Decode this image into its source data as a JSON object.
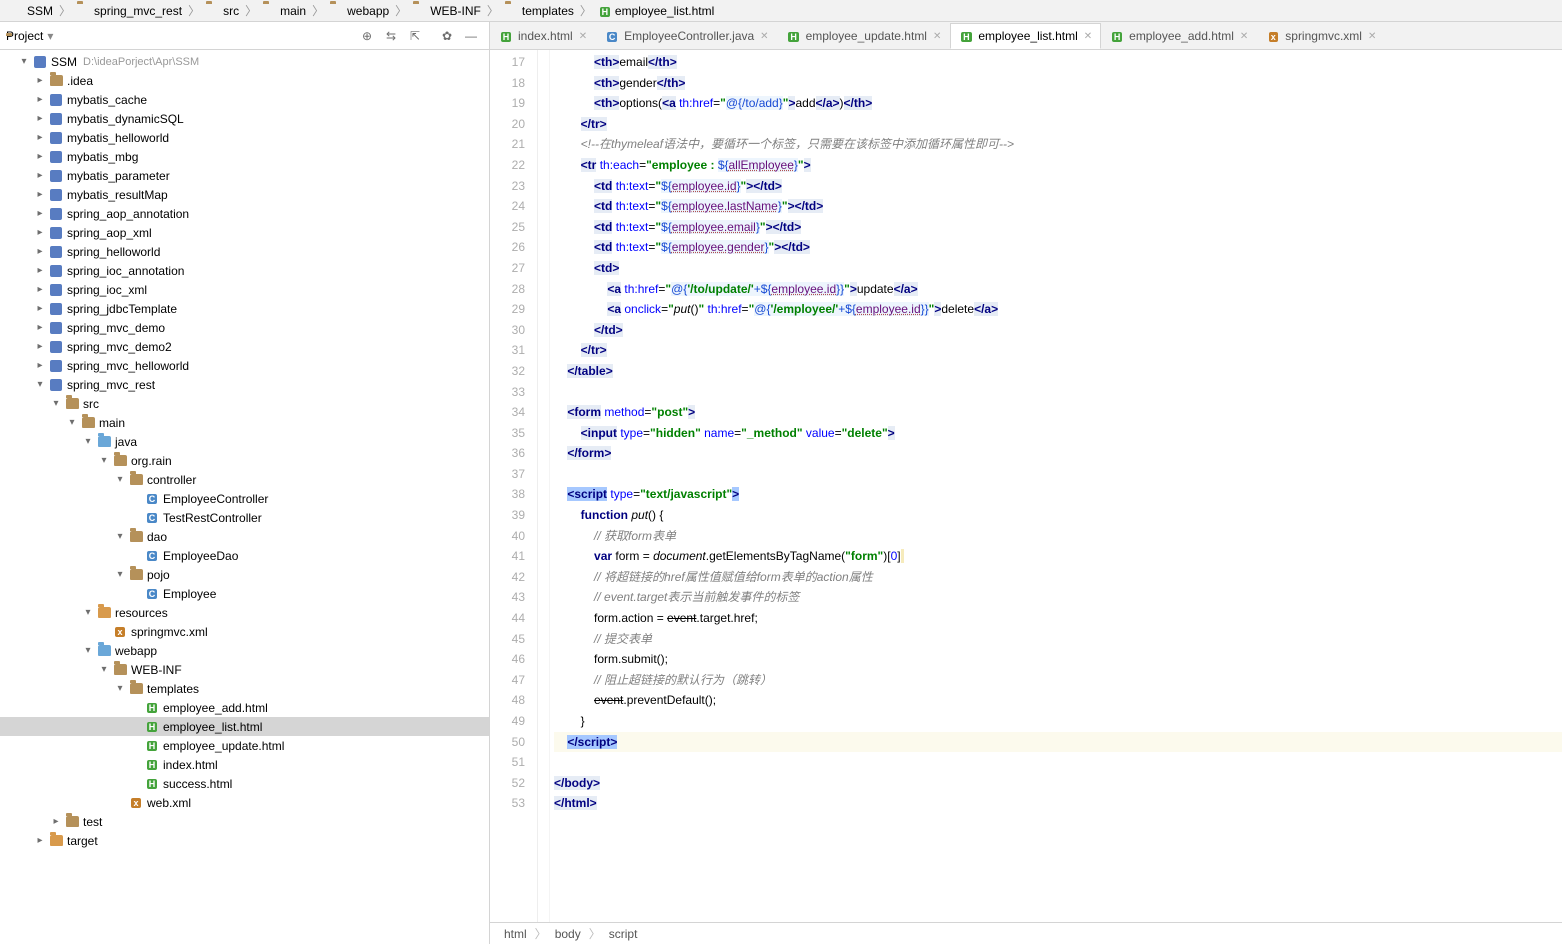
{
  "breadcrumb": [
    "SSM",
    "spring_mvc_rest",
    "src",
    "main",
    "webapp",
    "WEB-INF",
    "templates",
    "employee_list.html"
  ],
  "project_label": "Project",
  "root": {
    "name": "SSM",
    "hint": "D:\\ideaPorject\\Apr\\SSM"
  },
  "tree": [
    {
      "d": 1,
      "exp": true,
      "ic": "mod",
      "name": "SSM",
      "hint": "D:\\ideaPorject\\Apr\\SSM"
    },
    {
      "d": 2,
      "exp": false,
      "ic": "folder",
      "name": ".idea"
    },
    {
      "d": 2,
      "exp": false,
      "ic": "mod",
      "name": "mybatis_cache"
    },
    {
      "d": 2,
      "exp": false,
      "ic": "mod",
      "name": "mybatis_dynamicSQL"
    },
    {
      "d": 2,
      "exp": false,
      "ic": "mod",
      "name": "mybatis_helloworld"
    },
    {
      "d": 2,
      "exp": false,
      "ic": "mod",
      "name": "mybatis_mbg"
    },
    {
      "d": 2,
      "exp": false,
      "ic": "mod",
      "name": "mybatis_parameter"
    },
    {
      "d": 2,
      "exp": false,
      "ic": "mod",
      "name": "mybatis_resultMap"
    },
    {
      "d": 2,
      "exp": false,
      "ic": "mod",
      "name": "spring_aop_annotation"
    },
    {
      "d": 2,
      "exp": false,
      "ic": "mod",
      "name": "spring_aop_xml"
    },
    {
      "d": 2,
      "exp": false,
      "ic": "mod",
      "name": "spring_helloworld"
    },
    {
      "d": 2,
      "exp": false,
      "ic": "mod",
      "name": "spring_ioc_annotation"
    },
    {
      "d": 2,
      "exp": false,
      "ic": "mod",
      "name": "spring_ioc_xml"
    },
    {
      "d": 2,
      "exp": false,
      "ic": "mod",
      "name": "spring_jdbcTemplate"
    },
    {
      "d": 2,
      "exp": false,
      "ic": "mod",
      "name": "spring_mvc_demo"
    },
    {
      "d": 2,
      "exp": false,
      "ic": "mod",
      "name": "spring_mvc_demo2"
    },
    {
      "d": 2,
      "exp": false,
      "ic": "mod",
      "name": "spring_mvc_helloworld"
    },
    {
      "d": 2,
      "exp": true,
      "ic": "mod",
      "name": "spring_mvc_rest"
    },
    {
      "d": 3,
      "exp": true,
      "ic": "folder",
      "name": "src"
    },
    {
      "d": 4,
      "exp": true,
      "ic": "folder",
      "name": "main"
    },
    {
      "d": 5,
      "exp": true,
      "ic": "folder blue",
      "name": "java"
    },
    {
      "d": 6,
      "exp": true,
      "ic": "folder",
      "name": "org.rain"
    },
    {
      "d": 7,
      "exp": true,
      "ic": "folder",
      "name": "controller"
    },
    {
      "d": 8,
      "ic": "java",
      "name": "EmployeeController"
    },
    {
      "d": 8,
      "ic": "java",
      "name": "TestRestController"
    },
    {
      "d": 7,
      "exp": true,
      "ic": "folder",
      "name": "dao"
    },
    {
      "d": 8,
      "ic": "java",
      "name": "EmployeeDao"
    },
    {
      "d": 7,
      "exp": true,
      "ic": "folder",
      "name": "pojo"
    },
    {
      "d": 8,
      "ic": "java",
      "name": "Employee"
    },
    {
      "d": 5,
      "exp": true,
      "ic": "folder orange",
      "name": "resources"
    },
    {
      "d": 6,
      "ic": "xml",
      "name": "springmvc.xml"
    },
    {
      "d": 5,
      "exp": true,
      "ic": "folder blue",
      "name": "webapp"
    },
    {
      "d": 6,
      "exp": true,
      "ic": "folder",
      "name": "WEB-INF"
    },
    {
      "d": 7,
      "exp": true,
      "ic": "folder",
      "name": "templates"
    },
    {
      "d": 8,
      "ic": "html",
      "name": "employee_add.html"
    },
    {
      "d": 8,
      "ic": "html",
      "name": "employee_list.html",
      "sel": true
    },
    {
      "d": 8,
      "ic": "html",
      "name": "employee_update.html"
    },
    {
      "d": 8,
      "ic": "html",
      "name": "index.html"
    },
    {
      "d": 8,
      "ic": "html",
      "name": "success.html"
    },
    {
      "d": 7,
      "ic": "xml",
      "name": "web.xml"
    },
    {
      "d": 3,
      "exp": false,
      "ic": "folder",
      "name": "test"
    },
    {
      "d": 2,
      "exp": false,
      "ic": "folder orange",
      "name": "target"
    }
  ],
  "tabs": [
    {
      "ic": "html",
      "label": "index.html"
    },
    {
      "ic": "java",
      "label": "EmployeeController.java"
    },
    {
      "ic": "html",
      "label": "employee_update.html"
    },
    {
      "ic": "html",
      "label": "employee_list.html",
      "active": true
    },
    {
      "ic": "html",
      "label": "employee_add.html"
    },
    {
      "ic": "xml",
      "label": "springmvc.xml"
    }
  ],
  "first_line": 17,
  "code_html": [
    "            <span class='tagc'>&lt;th&gt;</span>email<span class='tagc'>&lt;/th&gt;</span>",
    "            <span class='tagc'>&lt;th&gt;</span>gender<span class='tagc'>&lt;/th&gt;</span>",
    "            <span class='tagc'>&lt;th&gt;</span>options(<span class='tagc'>&lt;a</span> <span class='attr'>th:href</span>=<span class='str'>\"</span><span class='spel'>@{/to/add}</span><span class='str'>\"</span><span class='tagc'>&gt;</span>add<span class='tagc'>&lt;/a&gt;</span>)<span class='tagc'>&lt;/th&gt;</span>",
    "        <span class='tagc'>&lt;/tr&gt;</span>",
    "        <span class='cmt'>&lt;!--在thymeleaf语法中，要循环一个标签，只需要在该标签中添加循环属性即可--&gt;</span>",
    "        <span class='tagc'>&lt;tr</span> <span class='attr'>th:each</span>=<span class='str'>\"employee : </span><span class='spel'>${<span class='expr'>allEmployee</span>}</span><span class='str'>\"</span><span class='tagc'>&gt;</span>",
    "            <span class='tagc'>&lt;td</span> <span class='attr'>th:text</span>=<span class='str'>\"</span><span class='spel'>${<span class='expr'>employee.id</span>}</span><span class='str'>\"</span><span class='tagc'>&gt;&lt;/td&gt;</span>",
    "            <span class='tagc'>&lt;td</span> <span class='attr'>th:text</span>=<span class='str'>\"</span><span class='spel'>${<span class='expr'>employee.lastName</span>}</span><span class='str'>\"</span><span class='tagc'>&gt;&lt;/td&gt;</span>",
    "            <span class='tagc'>&lt;td</span> <span class='attr'>th:text</span>=<span class='str'>\"</span><span class='spel'>${<span class='expr'>employee.email</span>}</span><span class='str'>\"</span><span class='tagc'>&gt;&lt;/td&gt;</span>",
    "            <span class='tagc'>&lt;td</span> <span class='attr'>th:text</span>=<span class='str'>\"</span><span class='spel'>${<span class='expr'>employee.gender</span>}</span><span class='str'>\"</span><span class='tagc'>&gt;&lt;/td&gt;</span>",
    "            <span class='tagc'>&lt;td&gt;</span>",
    "                <span class='tagc'>&lt;a</span> <span class='attr'>th:href</span>=<span class='str'>\"</span><span class='spel'>@{<span class='str'>'/to/update/'</span>+${<span class='expr'>employee.id</span>}}</span><span class='str'>\"</span><span class='tagc'>&gt;</span>update<span class='tagc'>&lt;/a&gt;</span>",
    "                <span class='tagc'>&lt;a</span> <span class='attr'>onclick</span>=<span class='str'>\"</span><span class='fn'>put</span>()<span class='str'>\"</span> <span class='attr'>th:href</span>=<span class='str'>\"</span><span class='spel'>@{<span class='str'>'/employee/'</span>+${<span class='expr'>employee.id</span>}}</span><span class='str'>\"</span><span class='tagc'>&gt;</span>delete<span class='tagc'>&lt;/a&gt;</span>",
    "            <span class='tagc'>&lt;/td&gt;</span>",
    "        <span class='tagc'>&lt;/tr&gt;</span>",
    "    <span class='tagc'>&lt;/table&gt;</span>",
    "",
    "    <span class='tagc'>&lt;form</span> <span class='attr'>method</span>=<span class='str'>\"post\"</span><span class='tagc'>&gt;</span>",
    "        <span class='tagc'>&lt;input</span> <span class='attr'>type</span>=<span class='str'>\"hidden\"</span> <span class='attr'>name</span>=<span class='str'>\"_method\"</span> <span class='attr'>value</span>=<span class='str'>\"delete\"</span><span class='tagc'>&gt;</span>",
    "    <span class='tagc'>&lt;/form&gt;</span>",
    "",
    "    <span class='tagcSel'>&lt;script</span> <span class='attr'>type</span>=<span class='str'>\"text/javascript\"</span><span class='tagcSel'>&gt;</span>",
    "        <span class='kw'>function</span> <span class='fn'>put</span>() {",
    "            <span class='cmt'>// 获取form表单</span>",
    "            <span class='kw'>var</span> form = <span class='fn'>document</span>.getElementsByTagName(<span class='str'>\"form\"</span>)[<span class='num'>0</span>]<span class='warn'> </span>",
    "            <span class='cmt'>// 将超链接的href属性值赋值给form表单的action属性</span>",
    "            <span class='cmt'>// event.target表示当前触发事件的标签</span>",
    "            form.action = <s>event</s>.target.href;",
    "            <span class='cmt'>// 提交表单</span>",
    "            form.submit();",
    "            <span class='cmt'>// 阻止超链接的默认行为（跳转）</span>",
    "            <s>event</s>.preventDefault();",
    "        }",
    "    <span class='tagcSel'>&lt;/script&gt;</span>",
    "",
    "<span class='tagc'>&lt;/body&gt;</span>",
    "<span class='tagc'>&lt;/html&gt;</span>"
  ],
  "current_line_idx": 33,
  "crumbbar": [
    "html",
    "body",
    "script"
  ]
}
